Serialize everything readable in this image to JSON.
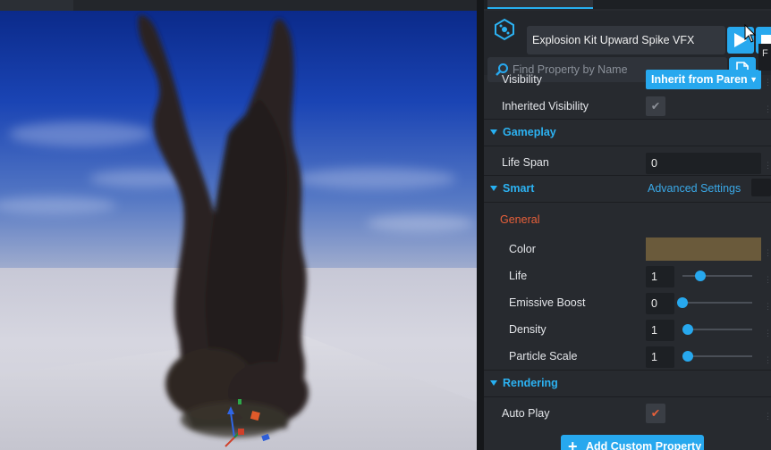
{
  "viewport": {
    "description_icons": [
      "gizmo-z-axis-icon",
      "gizmo-x-axis-icon",
      "gizmo-y-axis-icon"
    ]
  },
  "header": {
    "object_icon": "vfx-object-icon",
    "object_name": "Explosion Kit Upward Spike VFX",
    "search_placeholder": "Find Property by Name",
    "search_icon": "search-icon",
    "play_icon": "play-icon",
    "file_icon": "file-icon",
    "tooltip_fragment": "F"
  },
  "properties": {
    "visibility_label": "Visibility",
    "visibility_value": "Inherit from Paren",
    "inherited_visibility_label": "Inherited Visibility",
    "inherited_visibility_checked": "✔",
    "gameplay_section": "Gameplay",
    "life_span_label": "Life Span",
    "life_span_value": "0",
    "smart_section": "Smart",
    "advanced_settings": "Advanced Settings",
    "general_group": "General",
    "color_label": "Color",
    "color_value": "#6a5a3b",
    "life_label": "Life",
    "life_value": "1",
    "life_fraction": 0.25,
    "emissive_label": "Emissive Boost",
    "emissive_value": "0",
    "emissive_fraction": 0.0,
    "density_label": "Density",
    "density_value": "1",
    "density_fraction": 0.08,
    "particle_scale_label": "Particle Scale",
    "particle_scale_value": "1",
    "particle_scale_fraction": 0.08,
    "rendering_section": "Rendering",
    "auto_play_label": "Auto Play",
    "auto_play_checked": "✔",
    "add_custom_property": "Add Custom Property"
  },
  "colors": {
    "accent": "#27a8ee",
    "section_title": "#2cb2f2",
    "group_title": "#e8603a",
    "checkmark_active": "#e8603a"
  }
}
